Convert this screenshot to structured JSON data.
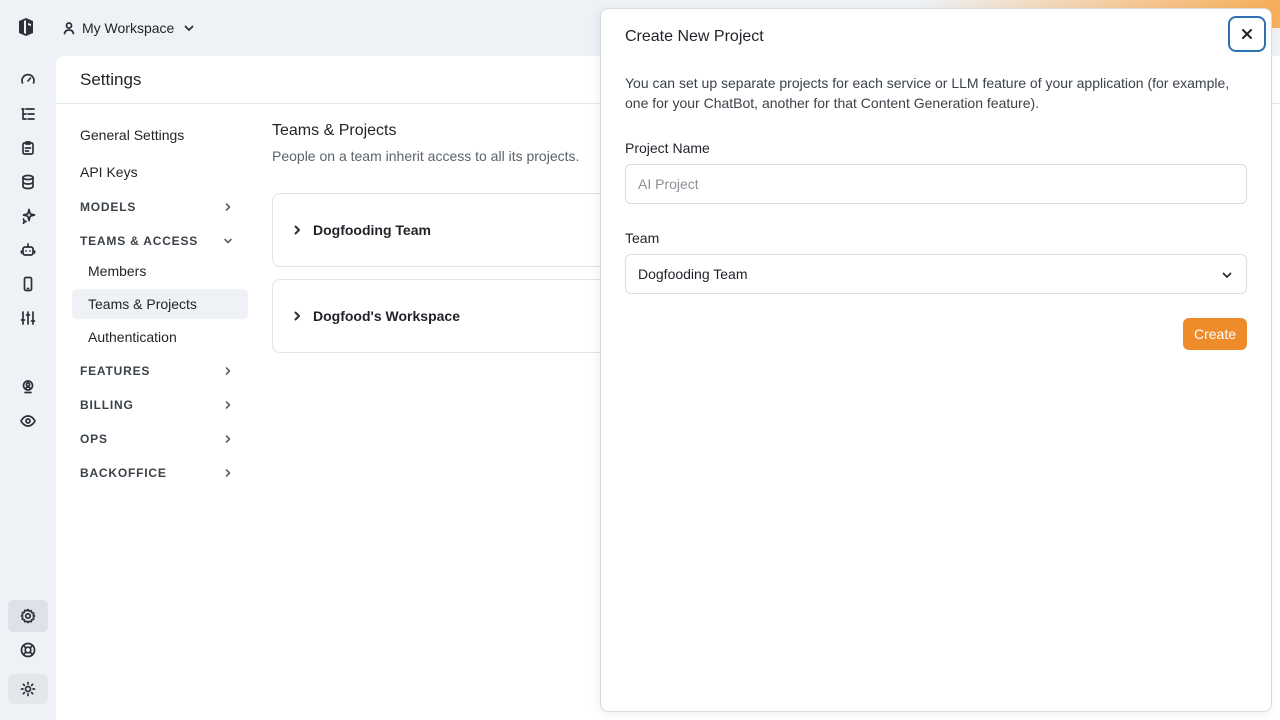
{
  "topbar": {
    "workspace_label": "My Workspace"
  },
  "settings": {
    "title": "Settings",
    "nav": {
      "general": "General Settings",
      "api_keys": "API Keys",
      "models": "MODELS",
      "teams_access": "TEAMS & ACCESS",
      "members": "Members",
      "teams_projects": "Teams & Projects",
      "authentication": "Authentication",
      "features": "FEATURES",
      "billing": "BILLING",
      "ops": "OPS",
      "backoffice": "BACKOFFICE"
    },
    "content": {
      "heading": "Teams & Projects",
      "description": "People on a team inherit access to all its projects.",
      "teams": [
        "Dogfooding Team",
        "Dogfood's Workspace"
      ]
    }
  },
  "modal": {
    "title": "Create New Project",
    "intro": "You can set up separate projects for each service or LLM feature of your application (for example, one for your ChatBot, another for that Content Generation feature).",
    "project_name_label": "Project Name",
    "project_name_placeholder": "AI Project",
    "project_name_value": "",
    "team_label": "Team",
    "team_selected": "Dogfooding Team",
    "create_label": "Create"
  },
  "colors": {
    "accent": "#ee8b2b",
    "focus_ring": "#2f6fb3"
  }
}
